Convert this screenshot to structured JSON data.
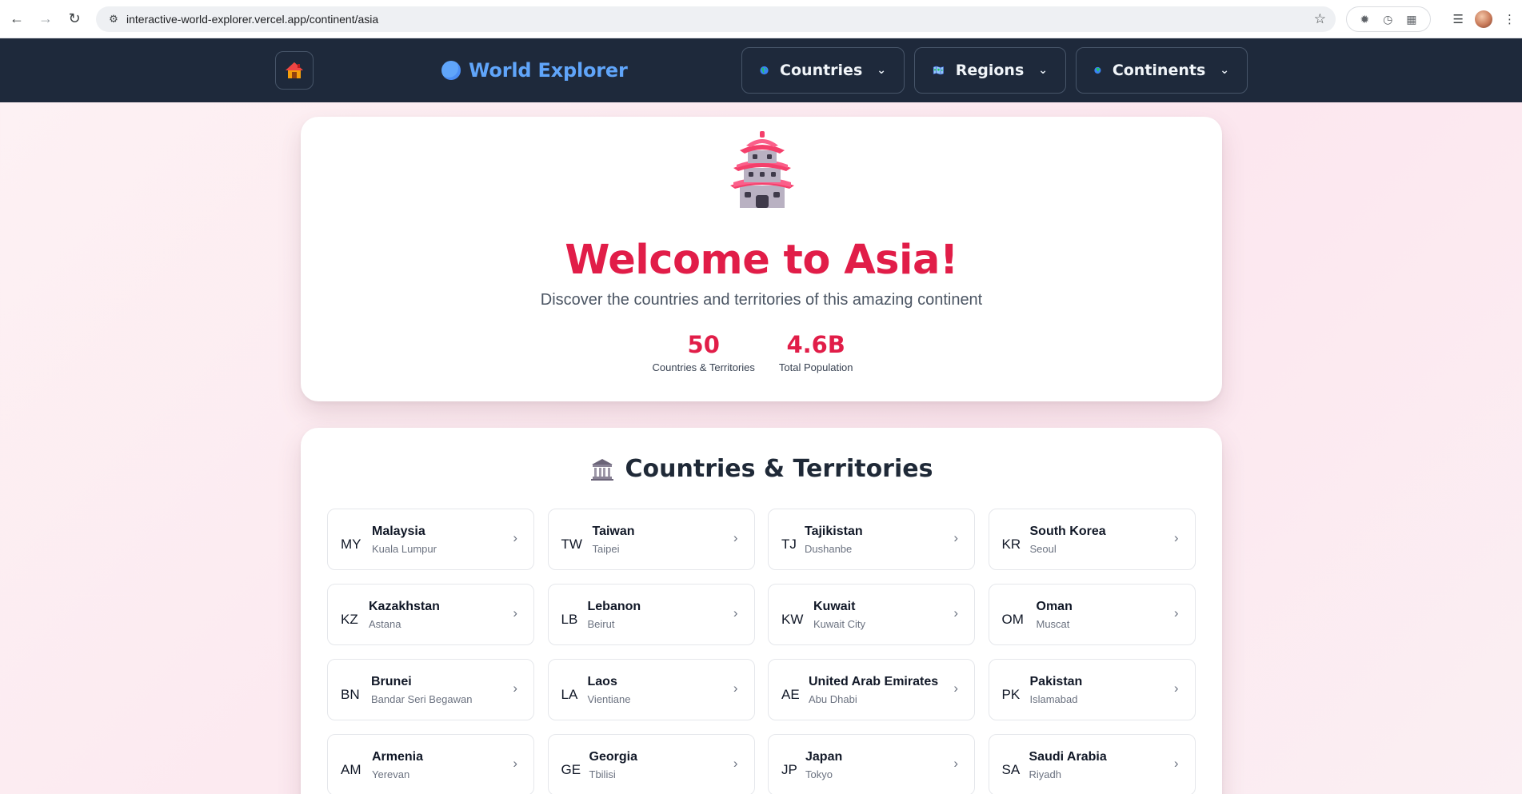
{
  "browser": {
    "url": "interactive-world-explorer.vercel.app/continent/asia"
  },
  "nav": {
    "brand": "World Explorer",
    "dropdowns": [
      {
        "label": "Countries",
        "icon": "globe-americas-icon"
      },
      {
        "label": "Regions",
        "icon": "map-icon"
      },
      {
        "label": "Continents",
        "icon": "globe-asia-icon"
      }
    ]
  },
  "hero": {
    "title": "Welcome to Asia!",
    "subtitle": "Discover the countries and territories of this amazing continent",
    "stats": [
      {
        "value": "50",
        "label": "Countries & Territories"
      },
      {
        "value": "4.6B",
        "label": "Total Population"
      }
    ]
  },
  "section": {
    "title": "Countries & Territories"
  },
  "countries": [
    {
      "code": "MY",
      "name": "Malaysia",
      "capital": "Kuala Lumpur"
    },
    {
      "code": "TW",
      "name": "Taiwan",
      "capital": "Taipei"
    },
    {
      "code": "TJ",
      "name": "Tajikistan",
      "capital": "Dushanbe"
    },
    {
      "code": "KR",
      "name": "South Korea",
      "capital": "Seoul"
    },
    {
      "code": "KZ",
      "name": "Kazakhstan",
      "capital": "Astana"
    },
    {
      "code": "LB",
      "name": "Lebanon",
      "capital": "Beirut"
    },
    {
      "code": "KW",
      "name": "Kuwait",
      "capital": "Kuwait City"
    },
    {
      "code": "OM",
      "name": "Oman",
      "capital": "Muscat"
    },
    {
      "code": "BN",
      "name": "Brunei",
      "capital": "Bandar Seri Begawan"
    },
    {
      "code": "LA",
      "name": "Laos",
      "capital": "Vientiane"
    },
    {
      "code": "AE",
      "name": "United Arab Emirates",
      "capital": "Abu Dhabi"
    },
    {
      "code": "PK",
      "name": "Pakistan",
      "capital": "Islamabad"
    },
    {
      "code": "AM",
      "name": "Armenia",
      "capital": "Yerevan"
    },
    {
      "code": "GE",
      "name": "Georgia",
      "capital": "Tbilisi"
    },
    {
      "code": "JP",
      "name": "Japan",
      "capital": "Tokyo"
    },
    {
      "code": "SA",
      "name": "Saudi Arabia",
      "capital": "Riyadh"
    }
  ]
}
